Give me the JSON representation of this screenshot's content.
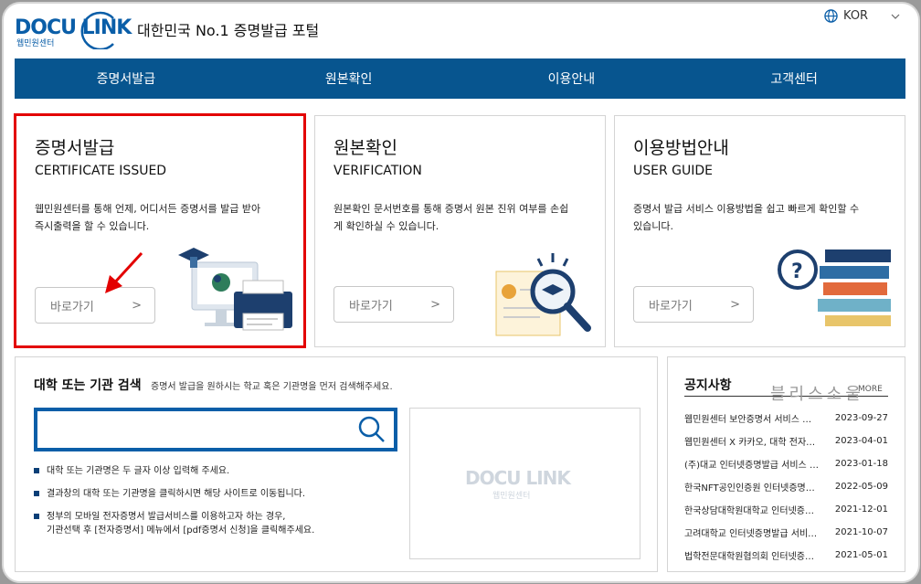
{
  "header": {
    "logo_text": "DOCU LINK",
    "logo_sub": "웹민원센터",
    "tagline": "대한민국 No.1 증명발급 포털",
    "language": "KOR"
  },
  "nav": [
    "증명서발급",
    "원본확인",
    "이용안내",
    "고객센터"
  ],
  "cards": [
    {
      "title": "증명서발급",
      "subtitle": "CERTIFICATE ISSUED",
      "desc_line1": "웹민원센터를 통해 언제, 어디서든 증명서를 발급 받아",
      "desc_line2": "즉시출력을 할 수 있습니다.",
      "button": "바로가기",
      "arrow": ">"
    },
    {
      "title": "원본확인",
      "subtitle": "VERIFICATION",
      "desc_line1": "원본확인 문서번호를 통해 증명서 원본 진위 여부를 손쉽",
      "desc_line2": "게 확인하실 수 있습니다.",
      "button": "바로가기",
      "arrow": ">"
    },
    {
      "title": "이용방법안내",
      "subtitle": "USER GUIDE",
      "desc_line1": "증명서 발급 서비스 이용방법을 쉽고 빠르게 확인할 수",
      "desc_line2": "있습니다.",
      "button": "바로가기",
      "arrow": ">"
    }
  ],
  "search": {
    "title": "대학 또는 기관 검색",
    "hint": "증명서 발급을 원하시는 학교 혹은 기관명을 먼저 검색해주세요.",
    "value": "",
    "bullets": [
      "대학 또는 기관명은 두 글자 이상 입력해 주세요.",
      "결과창의 대학 또는 기관명을 클릭하시면 해당 사이트로 이동됩니다.",
      "정부의 모바일 전자증명서 발급서비스를 이용하고자 하는 경우,",
      "기관선택 후 [전자증명서] 메뉴에서 [pdf증명서 신청]을 클릭해주세요."
    ],
    "result_logo": "DOCU LINK",
    "result_logo_sub": "웹민원센터"
  },
  "notice": {
    "title": "공지사항",
    "more": "MORE",
    "watermark": "블리스소울",
    "items": [
      {
        "title": "웹민원센터 보안증명서 서비스 …",
        "date": "2023-09-27"
      },
      {
        "title": "웹민원센터 X 카카오, 대학 전자…",
        "date": "2023-04-01"
      },
      {
        "title": "(주)대교 인터넷증명발급 서비스 …",
        "date": "2023-01-18"
      },
      {
        "title": "한국NFT공인인증원 인터넷증명…",
        "date": "2022-05-09"
      },
      {
        "title": "한국상담대학원대학교 인터넷증…",
        "date": "2021-12-01"
      },
      {
        "title": "고려대학교 인터넷증명발급 서비…",
        "date": "2021-10-07"
      },
      {
        "title": "법학전문대학원협의회 인터넷증…",
        "date": "2021-05-01"
      }
    ]
  },
  "colors": {
    "brand": "#07558f",
    "highlight": "#e30000",
    "background": "#ffffff"
  }
}
